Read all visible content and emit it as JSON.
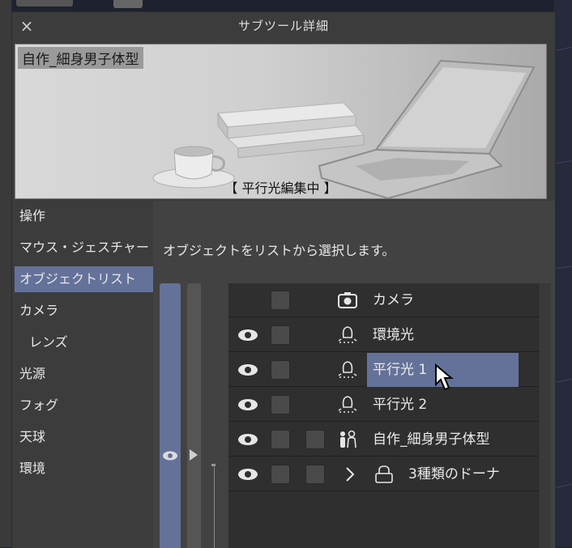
{
  "window": {
    "title": "サブツール詳細",
    "close_glyph": "×"
  },
  "preview": {
    "object_name": "自作_細身男子体型",
    "status": "【 平行光編集中 】"
  },
  "nav": {
    "items": [
      {
        "label": "操作"
      },
      {
        "label": "マウス・ジェスチャー"
      },
      {
        "label": "オブジェクトリスト",
        "active": true
      },
      {
        "label": "カメラ"
      },
      {
        "label": "レンズ"
      },
      {
        "label": "光源"
      },
      {
        "label": "フォグ"
      },
      {
        "label": "天球"
      },
      {
        "label": "環境"
      }
    ]
  },
  "content": {
    "description": "オブジェクトをリストから選択します。"
  },
  "object_list": [
    {
      "label": "カメラ",
      "icon": "camera-icon",
      "visible_toggle": false
    },
    {
      "label": "環境光",
      "icon": "light-bulb-icon",
      "visible_toggle": true
    },
    {
      "label": "平行光 1",
      "icon": "light-bulb-icon",
      "visible_toggle": true,
      "selected": true
    },
    {
      "label": "平行光 2",
      "icon": "light-bulb-icon",
      "visible_toggle": true
    },
    {
      "label": "自作_細身男子体型",
      "icon": "figure-icon",
      "visible_toggle": true
    },
    {
      "label": "3種類のドーナ",
      "icon": "lock-icon",
      "visible_toggle": true,
      "expandable": true
    }
  ],
  "colors": {
    "accent": "#64729a",
    "dialog_bg": "#3c3c3c",
    "list_bg": "#2f2f2f"
  }
}
